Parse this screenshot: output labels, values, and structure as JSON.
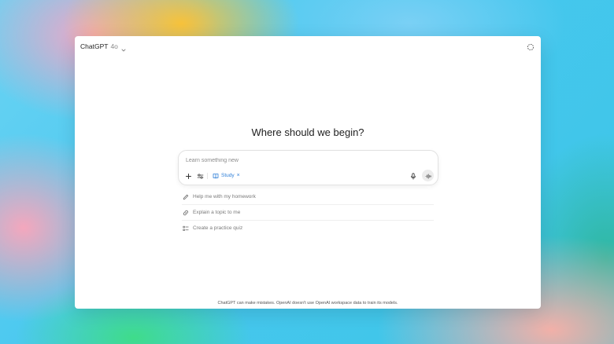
{
  "header": {
    "model_name": "ChatGPT",
    "model_version": "4o",
    "model_switch_icon": "chevron-down-icon",
    "corner_icon": "dashed-circle-icon"
  },
  "main": {
    "headline": "Where should we begin?"
  },
  "composer": {
    "placeholder": "Learn something new",
    "value": "",
    "tools": [
      {
        "name": "add",
        "icon": "plus-icon"
      },
      {
        "name": "tools",
        "icon": "sliders-icon"
      }
    ],
    "active_tool": {
      "label": "Study",
      "icon": "book-icon",
      "remove_icon": "close-icon",
      "color": "#2f7fd8"
    },
    "mic_icon": "microphone-icon",
    "send_icon": "voice-mode-icon"
  },
  "suggestions": [
    {
      "label": "Help me with my homework",
      "icon": "pencil-icon"
    },
    {
      "label": "Explain a topic to me",
      "icon": "link-icon"
    },
    {
      "label": "Create a practice quiz",
      "icon": "checklist-icon"
    }
  ],
  "footer": {
    "disclaimer": "ChatGPT can make mistakes. OpenAI doesn't use OpenAI workspace data to train its models."
  },
  "colors": {
    "accent": "#2f7fd8",
    "window_bg": "#ffffff",
    "text_primary": "#1e1e1e",
    "text_muted": "#7a7a7a"
  }
}
